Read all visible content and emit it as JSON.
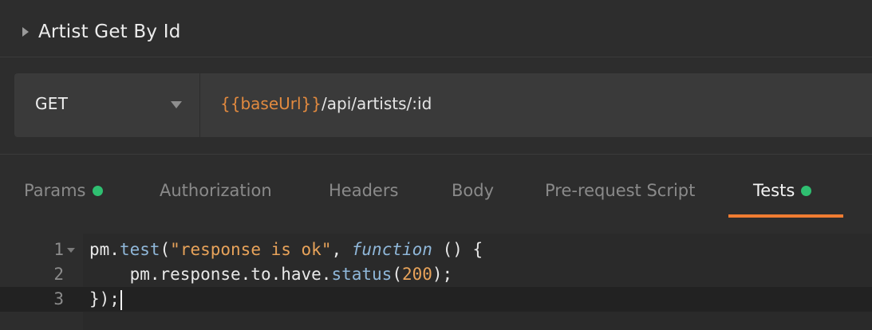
{
  "request": {
    "title": "Artist Get By Id"
  },
  "url_bar": {
    "method": "GET",
    "url_variable": "{{baseUrl}}",
    "url_path": "/api/artists/:id"
  },
  "tabs": [
    {
      "label": "Params",
      "has_indicator": true
    },
    {
      "label": "Authorization",
      "has_indicator": false
    },
    {
      "label": "Headers",
      "has_indicator": false
    },
    {
      "label": "Body",
      "has_indicator": false
    },
    {
      "label": "Pre-request Script",
      "has_indicator": false
    },
    {
      "label": "Tests",
      "has_indicator": true,
      "active": true
    }
  ],
  "editor": {
    "line_numbers": [
      "1",
      "2",
      "3"
    ],
    "line1": {
      "obj": "pm.",
      "fn": "test",
      "open": "(",
      "str": "\"response is ok\"",
      "comma": ", ",
      "keyword": "function",
      "rest": " () {"
    },
    "line2": {
      "indent": "    ",
      "chain": "pm.response.to.have.",
      "fn": "status",
      "open": "(",
      "num": "200",
      "close": ");"
    },
    "line3": {
      "text": "});"
    }
  },
  "colors": {
    "accent_orange": "#f07c32",
    "indicator_green": "#2fbf71",
    "url_variable": "#e28a3f"
  }
}
